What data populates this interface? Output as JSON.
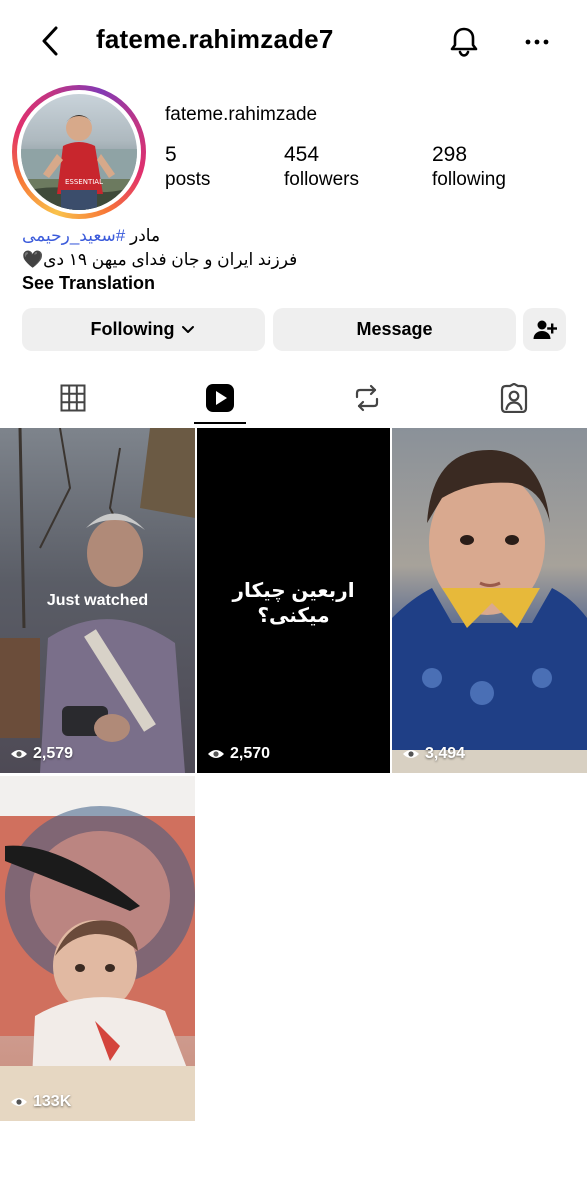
{
  "header": {
    "username": "fateme.rahimzade7",
    "back_icon": "chevron-left-icon",
    "notification_icon": "bell-icon",
    "more_icon": "more-horizontal-icon"
  },
  "profile": {
    "display_name": "fateme.rahimzade",
    "stats": [
      {
        "value": "5",
        "label": "posts"
      },
      {
        "value": "454",
        "label": "followers"
      },
      {
        "value": "298",
        "label": "following"
      }
    ],
    "bio_line1_prefix": "مادر ",
    "bio_line1_tag": "#سعید_رحیمی",
    "bio_line2": "فرزند ایران و جان فدای میهن ۱۹ دی🖤",
    "see_translation": "See Translation"
  },
  "actions": {
    "following_label": "Following",
    "message_label": "Message",
    "add_user_icon": "person-add-icon"
  },
  "tabs": [
    {
      "name": "grid",
      "icon": "grid-icon",
      "active": false
    },
    {
      "name": "reels",
      "icon": "reels-play-icon",
      "active": true
    },
    {
      "name": "reposts",
      "icon": "repost-icon",
      "active": false
    },
    {
      "name": "tagged",
      "icon": "tagged-person-icon",
      "active": false
    }
  ],
  "reels": [
    {
      "views": "2,579",
      "overlay": "Just watched"
    },
    {
      "views": "2,570",
      "overlay": "اربعین چیکار میکنی؟"
    },
    {
      "views": "3,494",
      "overlay": ""
    },
    {
      "views": "133K",
      "overlay": ""
    }
  ],
  "colors": {
    "hashtag": "#3b5bdb",
    "button_bg": "#efefef",
    "story_ring": [
      "#f9c24b",
      "#f77737",
      "#e1306c",
      "#c13584",
      "#833ab4"
    ]
  }
}
